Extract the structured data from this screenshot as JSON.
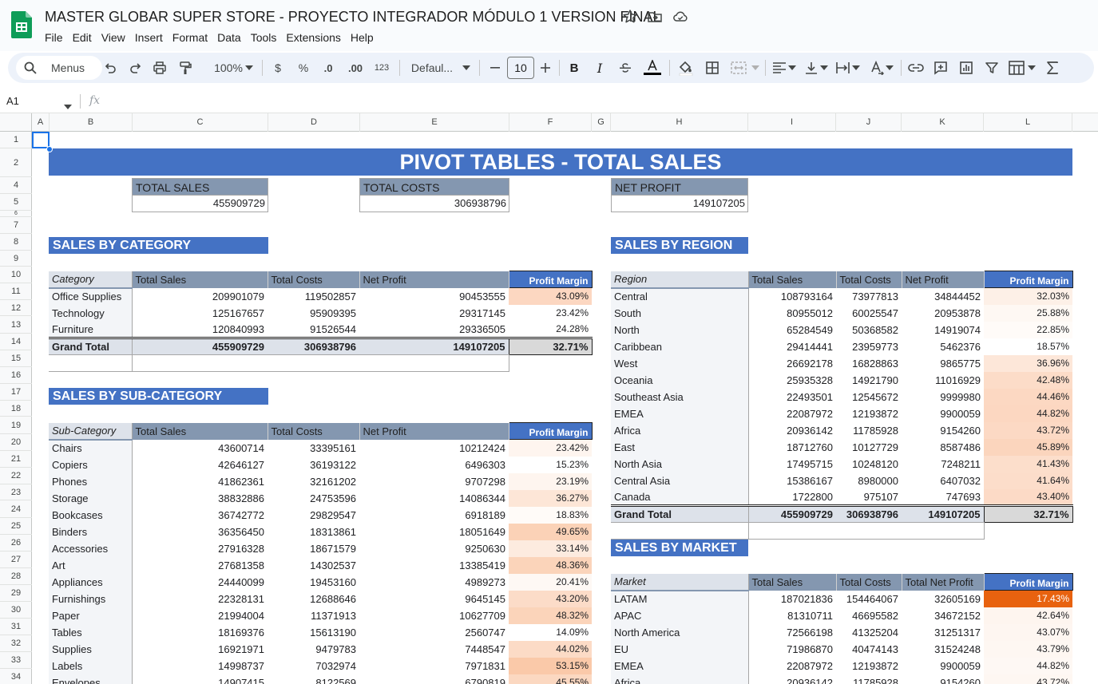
{
  "app": {
    "title": "MASTER GLOBAR SUPER STORE - PROYECTO INTEGRADOR MÓDULO 1 VERSION FINAL",
    "menu": [
      "File",
      "Edit",
      "View",
      "Insert",
      "Format",
      "Data",
      "Tools",
      "Extensions",
      "Help"
    ]
  },
  "toolbar": {
    "search_label": "Menus",
    "zoom": "100%",
    "currency": "$",
    "percent": "%",
    "dec_decrease": ".0",
    "dec_increase": ".00",
    "number_format": "123",
    "font": "Defaul...",
    "font_size": "10",
    "bold": "B",
    "italic": "I"
  },
  "formula_bar": {
    "cell_ref": "A1",
    "fx": "fx"
  },
  "columns": [
    "A",
    "B",
    "C",
    "D",
    "E",
    "F",
    "G",
    "H",
    "I",
    "J",
    "K",
    "L"
  ],
  "rows": [
    "1",
    "2",
    "4",
    "5",
    "6",
    "7",
    "8",
    "9",
    "10",
    "11",
    "12",
    "13",
    "14",
    "15",
    "16",
    "17",
    "18",
    "19",
    "20",
    "21",
    "22",
    "23",
    "24",
    "25",
    "26",
    "27",
    "28",
    "29",
    "30",
    "31",
    "32",
    "33",
    "34"
  ],
  "sheet": {
    "main_title": "PIVOT TABLES - TOTAL SALES",
    "kpis": [
      {
        "label": "TOTAL SALES",
        "value": "455909729"
      },
      {
        "label": "TOTAL COSTS",
        "value": "306938796"
      },
      {
        "label": "NET PROFIT",
        "value": "149107205"
      }
    ],
    "category": {
      "title": "SALES BY CATEGORY",
      "headers": [
        "Category",
        "Total Sales",
        "Total Costs",
        "Net Profit",
        "Profit Margin"
      ],
      "rows": [
        {
          "name": "Office Supplies",
          "sales": "209901079",
          "costs": "119502857",
          "profit": "90453555",
          "margin": "43.09%",
          "bg": "#fcd7c1"
        },
        {
          "name": "Technology",
          "sales": "125167657",
          "costs": "95909395",
          "profit": "29317145",
          "margin": "23.42%",
          "bg": "#ffffff"
        },
        {
          "name": "Furniture",
          "sales": "120840993",
          "costs": "91526544",
          "profit": "29336505",
          "margin": "24.28%",
          "bg": "#ffffff"
        }
      ],
      "total": {
        "name": "Grand Total",
        "sales": "455909729",
        "costs": "306938796",
        "profit": "149107205",
        "margin": "32.71%"
      }
    },
    "subcategory": {
      "title": "SALES BY SUB-CATEGORY",
      "headers": [
        "Sub-Category",
        "Total Sales",
        "Total Costs",
        "Net Profit",
        "Profit Margin"
      ],
      "rows": [
        {
          "name": "Chairs",
          "sales": "43600714",
          "costs": "33395161",
          "profit": "10212424",
          "margin": "23.42%",
          "bg": "#fef5ef"
        },
        {
          "name": "Copiers",
          "sales": "42646127",
          "costs": "36193122",
          "profit": "6496303",
          "margin": "15.23%",
          "bg": "#ffffff"
        },
        {
          "name": "Phones",
          "sales": "41862361",
          "costs": "32161202",
          "profit": "9707298",
          "margin": "23.19%",
          "bg": "#fef5ef"
        },
        {
          "name": "Storage",
          "sales": "38832886",
          "costs": "24753596",
          "profit": "14086344",
          "margin": "36.27%",
          "bg": "#fde6d7"
        },
        {
          "name": "Bookcases",
          "sales": "36742772",
          "costs": "29829547",
          "profit": "6918189",
          "margin": "18.83%",
          "bg": "#fffbf8"
        },
        {
          "name": "Binders",
          "sales": "36356450",
          "costs": "18313861",
          "profit": "18051649",
          "margin": "49.65%",
          "bg": "#fbd2b7"
        },
        {
          "name": "Accessories",
          "sales": "27916328",
          "costs": "18671579",
          "profit": "9250630",
          "margin": "33.14%",
          "bg": "#fdebdf"
        },
        {
          "name": "Art",
          "sales": "27681358",
          "costs": "14302537",
          "profit": "13385419",
          "margin": "48.36%",
          "bg": "#fbd4ba"
        },
        {
          "name": "Appliances",
          "sales": "24440099",
          "costs": "19453160",
          "profit": "4989273",
          "margin": "20.41%",
          "bg": "#fef8f4"
        },
        {
          "name": "Furnishings",
          "sales": "22328131",
          "costs": "12688646",
          "profit": "9645145",
          "margin": "43.20%",
          "bg": "#fcdcc8"
        },
        {
          "name": "Paper",
          "sales": "21994004",
          "costs": "11371913",
          "profit": "10627709",
          "margin": "48.32%",
          "bg": "#fbd4ba"
        },
        {
          "name": "Tables",
          "sales": "18169376",
          "costs": "15613190",
          "profit": "2560747",
          "margin": "14.09%",
          "bg": "#ffffff"
        },
        {
          "name": "Supplies",
          "sales": "16921971",
          "costs": "9479783",
          "profit": "7448547",
          "margin": "44.02%",
          "bg": "#fcdbc6"
        },
        {
          "name": "Labels",
          "sales": "14998737",
          "costs": "7032974",
          "profit": "7971831",
          "margin": "53.15%",
          "bg": "#fac9a9"
        },
        {
          "name": "Envelopes",
          "sales": "14907415",
          "costs": "8122569",
          "profit": "6790819",
          "margin": "45.55%",
          "bg": "#fbd8c1"
        }
      ]
    },
    "region": {
      "title": "SALES BY REGION",
      "headers": [
        "Region",
        "Total Sales",
        "Total Costs",
        "Net Profit",
        "Profit Margin"
      ],
      "rows": [
        {
          "name": "Central",
          "sales": "108793164",
          "costs": "73977813",
          "profit": "34844452",
          "margin": "32.03%",
          "bg": "#fdf0e7"
        },
        {
          "name": "South",
          "sales": "80955012",
          "costs": "60025547",
          "profit": "20953878",
          "margin": "25.88%",
          "bg": "#fef8f3"
        },
        {
          "name": "North",
          "sales": "65284549",
          "costs": "50368582",
          "profit": "14919074",
          "margin": "22.85%",
          "bg": "#fffbf8"
        },
        {
          "name": "Caribbean",
          "sales": "29414441",
          "costs": "23959773",
          "profit": "5462376",
          "margin": "18.57%",
          "bg": "#ffffff"
        },
        {
          "name": "West",
          "sales": "26692178",
          "costs": "16828863",
          "profit": "9865775",
          "margin": "36.96%",
          "bg": "#fde7d9"
        },
        {
          "name": "Oceania",
          "sales": "25935328",
          "costs": "14921790",
          "profit": "11016929",
          "margin": "42.48%",
          "bg": "#fcdcc8"
        },
        {
          "name": "Southeast Asia",
          "sales": "22493501",
          "costs": "12545672",
          "profit": "9999980",
          "margin": "44.46%",
          "bg": "#fcd8c2"
        },
        {
          "name": "EMEA",
          "sales": "22087972",
          "costs": "12193872",
          "profit": "9900059",
          "margin": "44.82%",
          "bg": "#fcd7c1"
        },
        {
          "name": "Africa",
          "sales": "20936142",
          "costs": "11785928",
          "profit": "9154260",
          "margin": "43.72%",
          "bg": "#fcd9c4"
        },
        {
          "name": "East",
          "sales": "18712760",
          "costs": "10127729",
          "profit": "8587486",
          "margin": "45.89%",
          "bg": "#fbd5bd"
        },
        {
          "name": "North Asia",
          "sales": "17495715",
          "costs": "10248120",
          "profit": "7248211",
          "margin": "41.43%",
          "bg": "#fcdecb"
        },
        {
          "name": "Central Asia",
          "sales": "15386167",
          "costs": "8980000",
          "profit": "6407032",
          "margin": "41.64%",
          "bg": "#fcddca"
        },
        {
          "name": "Canada",
          "sales": "1722800",
          "costs": "975107",
          "profit": "747693",
          "margin": "43.40%",
          "bg": "#fcdac6"
        }
      ],
      "total": {
        "name": "Grand Total",
        "sales": "455909729",
        "costs": "306938796",
        "profit": "149107205",
        "margin": "32.71%"
      }
    },
    "market": {
      "title": "SALES BY MARKET",
      "headers": [
        "Market",
        "Total Sales",
        "Total Costs",
        "Total Net Profit",
        "Profit Margin"
      ],
      "rows": [
        {
          "name": "LATAM",
          "sales": "187021836",
          "costs": "154464067",
          "profit": "32605169",
          "margin": "17.43%",
          "bg": "#e8620f"
        },
        {
          "name": "APAC",
          "sales": "81310711",
          "costs": "46695582",
          "profit": "34672152",
          "margin": "42.64%",
          "bg": "#fef5ef"
        },
        {
          "name": "North America",
          "sales": "72566198",
          "costs": "41325204",
          "profit": "31251317",
          "margin": "43.07%",
          "bg": "#fef6f1"
        },
        {
          "name": "EU",
          "sales": "71986870",
          "costs": "40474143",
          "profit": "31524248",
          "margin": "43.79%",
          "bg": "#fef7f2"
        },
        {
          "name": "EMEA",
          "sales": "22087972",
          "costs": "12193872",
          "profit": "9900059",
          "margin": "44.82%",
          "bg": "#fef8f4"
        },
        {
          "name": "Africa",
          "sales": "20936142",
          "costs": "11785928",
          "profit": "9154260",
          "margin": "43.72%",
          "bg": "#fef7f2"
        }
      ]
    }
  },
  "colors": {
    "banner": "#4472c4",
    "header": "#8497b0",
    "accent": "#1a73e8"
  }
}
